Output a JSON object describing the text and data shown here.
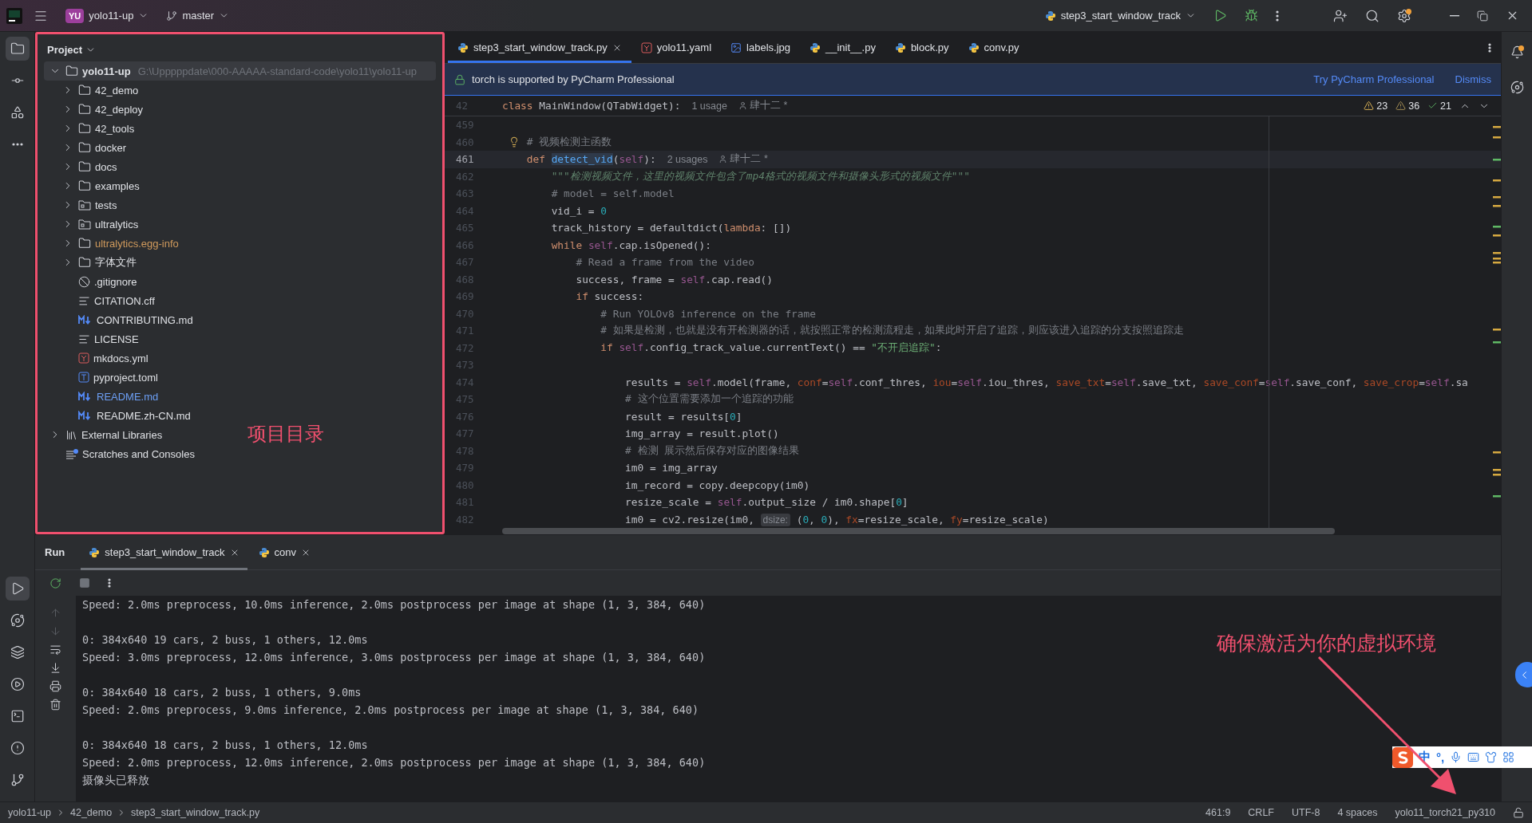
{
  "toolbar": {
    "project_badge": "YU",
    "project": "yolo11-up",
    "branch": "master",
    "run_config": "step3_start_window_track",
    "settings_update": true,
    "notifications_unread": true
  },
  "left_toolbar": {
    "top": [
      {
        "kind": "project",
        "selected": true
      },
      {
        "kind": "commit",
        "selected": false
      },
      {
        "kind": "structure",
        "selected": false
      },
      {
        "kind": "more",
        "selected": false
      }
    ],
    "bottom": [
      {
        "kind": "run",
        "selected": true
      },
      {
        "kind": "python-console",
        "selected": false
      },
      {
        "kind": "packages",
        "selected": false
      },
      {
        "kind": "services",
        "selected": false
      },
      {
        "kind": "terminal",
        "selected": false
      },
      {
        "kind": "problems",
        "selected": false
      },
      {
        "kind": "git",
        "selected": false
      }
    ]
  },
  "project": {
    "title": "Project",
    "root": {
      "name": "yolo11-up",
      "path": "G:\\Upppppdate\\000-AAAAA-standard-code\\yolo11\\yolo11-up",
      "expanded": true,
      "selected": true,
      "children": [
        {
          "name": "42_demo",
          "kind": "folder",
          "expanded": false
        },
        {
          "name": "42_deploy",
          "kind": "folder",
          "expanded": false
        },
        {
          "name": "42_tools",
          "kind": "folder",
          "expanded": false
        },
        {
          "name": "docker",
          "kind": "folder",
          "expanded": false
        },
        {
          "name": "docs",
          "kind": "folder",
          "expanded": false
        },
        {
          "name": "examples",
          "kind": "folder",
          "expanded": false
        },
        {
          "name": "tests",
          "kind": "source-folder",
          "expanded": false
        },
        {
          "name": "ultralytics",
          "kind": "source-folder",
          "expanded": false
        },
        {
          "name": "ultralytics.egg-info",
          "kind": "folder",
          "expanded": false,
          "color": "#d09a5c"
        },
        {
          "name": "字体文件",
          "kind": "folder",
          "expanded": false
        },
        {
          "name": ".gitignore",
          "kind": "ignore"
        },
        {
          "name": "CITATION.cff",
          "kind": "text"
        },
        {
          "name": "CONTRIBUTING.md",
          "kind": "markdown"
        },
        {
          "name": "LICENSE",
          "kind": "text"
        },
        {
          "name": "mkdocs.yml",
          "kind": "yaml"
        },
        {
          "name": "pyproject.toml",
          "kind": "toml"
        },
        {
          "name": "README.md",
          "kind": "markdown",
          "color": "#6c9ff5"
        },
        {
          "name": "README.zh-CN.md",
          "kind": "markdown"
        }
      ]
    },
    "extra": [
      {
        "name": "External Libraries",
        "kind": "libraries",
        "expanded": false
      },
      {
        "name": "Scratches and Consoles",
        "kind": "scratches"
      }
    ]
  },
  "editor_tabs": [
    {
      "label": "step3_start_window_track.py",
      "kind": "python",
      "selected": true
    },
    {
      "label": "yolo11.yaml",
      "kind": "yaml",
      "selected": false
    },
    {
      "label": "labels.jpg",
      "kind": "image",
      "selected": false
    },
    {
      "label": "__init__.py",
      "kind": "python",
      "selected": false
    },
    {
      "label": "block.py",
      "kind": "python",
      "selected": false
    },
    {
      "label": "conv.py",
      "kind": "python",
      "selected": false
    }
  ],
  "banner": {
    "text": "torch is supported by PyCharm Professional",
    "action": "Try PyCharm Professional",
    "dismiss": "Dismiss"
  },
  "inspections": {
    "warnings": "23",
    "weak_warnings": "36",
    "typos": "21"
  },
  "sticky_line": {
    "n": "42",
    "tokens": [
      {
        "kind": "kw",
        "t": "class"
      },
      {
        "kind": "plain",
        "t": " MainWindow(QTabWidget):"
      },
      {
        "kind": "hint",
        "t": "1 usage"
      },
      {
        "kind": "author",
        "t": "肆十二 *"
      }
    ]
  },
  "code_lines": [
    {
      "n": "459",
      "current": false,
      "bulb": false
    },
    {
      "n": "460",
      "current": false,
      "bulb": true,
      "tokens": [
        {
          "kind": "cmt",
          "t": "    # 视频检测主函数"
        }
      ]
    },
    {
      "n": "461",
      "current": true,
      "bulb": false,
      "tokens": [
        {
          "kind": "kw",
          "t": "    def "
        },
        {
          "kind": "fn",
          "t": "detect_vid"
        },
        {
          "kind": "plain",
          "t": "("
        },
        {
          "kind": "self",
          "t": "self"
        },
        {
          "kind": "plain",
          "t": "):"
        },
        {
          "kind": "hint",
          "t": "2 usages"
        },
        {
          "kind": "author",
          "t": "肆十二 *"
        }
      ]
    },
    {
      "n": "462",
      "current": false,
      "bulb": false,
      "tokens": [
        {
          "kind": "doc",
          "t": "        \"\"\"检测视频文件，这里的视频文件包含了mp4格式的视频文件和摄像头形式的视频文件\"\"\""
        }
      ]
    },
    {
      "n": "463",
      "current": false,
      "bulb": false,
      "tokens": [
        {
          "kind": "cmt",
          "t": "        # model = self.model"
        }
      ]
    },
    {
      "n": "464",
      "current": false,
      "bulb": false,
      "tokens": [
        {
          "kind": "plain",
          "t": "        vid_i = "
        },
        {
          "kind": "num",
          "t": "0"
        }
      ]
    },
    {
      "n": "465",
      "current": false,
      "bulb": false,
      "tokens": [
        {
          "kind": "plain",
          "t": "        track_history = defaultdict("
        },
        {
          "kind": "kw",
          "t": "lambda"
        },
        {
          "kind": "plain",
          "t": ": [])"
        }
      ]
    },
    {
      "n": "466",
      "current": false,
      "bulb": false,
      "tokens": [
        {
          "kind": "kw",
          "t": "        while "
        },
        {
          "kind": "self",
          "t": "self"
        },
        {
          "kind": "plain",
          "t": ".cap.isOpened():"
        }
      ]
    },
    {
      "n": "467",
      "current": false,
      "bulb": false,
      "tokens": [
        {
          "kind": "cmt",
          "t": "            # Read a frame from the video"
        }
      ]
    },
    {
      "n": "468",
      "current": false,
      "bulb": false,
      "tokens": [
        {
          "kind": "plain",
          "t": "            success, frame = "
        },
        {
          "kind": "self",
          "t": "self"
        },
        {
          "kind": "plain",
          "t": ".cap.read()"
        }
      ]
    },
    {
      "n": "469",
      "current": false,
      "bulb": false,
      "tokens": [
        {
          "kind": "kw",
          "t": "            if"
        },
        {
          "kind": "plain",
          "t": " success:"
        }
      ]
    },
    {
      "n": "470",
      "current": false,
      "bulb": false,
      "tokens": [
        {
          "kind": "cmt",
          "t": "                # Run YOLOv8 inference on the frame"
        }
      ]
    },
    {
      "n": "471",
      "current": false,
      "bulb": false,
      "tokens": [
        {
          "kind": "cmt",
          "t": "                # 如果是检测，也就是没有开检测器的话，就按照正常的检测流程走，如果此时开启了追踪，则应该进入追踪的分支按照追踪走"
        }
      ]
    },
    {
      "n": "472",
      "current": false,
      "bulb": false,
      "tokens": [
        {
          "kind": "kw",
          "t": "                if "
        },
        {
          "kind": "self",
          "t": "self"
        },
        {
          "kind": "plain",
          "t": ".config_track_value.currentText() == "
        },
        {
          "kind": "str",
          "t": "\"不开启追踪\""
        },
        {
          "kind": "plain",
          "t": ":"
        }
      ]
    },
    {
      "n": "473",
      "current": false,
      "bulb": false
    },
    {
      "n": "474",
      "current": false,
      "bulb": false,
      "tokens": [
        {
          "kind": "plain",
          "t": "                    results = "
        },
        {
          "kind": "self",
          "t": "self"
        },
        {
          "kind": "plain",
          "t": ".model(frame, "
        },
        {
          "kind": "param",
          "t": "conf"
        },
        {
          "kind": "plain",
          "t": "="
        },
        {
          "kind": "self",
          "t": "self"
        },
        {
          "kind": "plain",
          "t": ".conf_thres, "
        },
        {
          "kind": "param",
          "t": "iou"
        },
        {
          "kind": "plain",
          "t": "="
        },
        {
          "kind": "self",
          "t": "self"
        },
        {
          "kind": "plain",
          "t": ".iou_thres, "
        },
        {
          "kind": "param",
          "t": "save_txt"
        },
        {
          "kind": "plain",
          "t": "="
        },
        {
          "kind": "self",
          "t": "self"
        },
        {
          "kind": "plain",
          "t": ".save_txt, "
        },
        {
          "kind": "param",
          "t": "save_conf"
        },
        {
          "kind": "plain",
          "t": "="
        },
        {
          "kind": "self",
          "t": "self"
        },
        {
          "kind": "plain",
          "t": ".save_conf, "
        },
        {
          "kind": "param",
          "t": "save_crop"
        },
        {
          "kind": "plain",
          "t": "="
        },
        {
          "kind": "self",
          "t": "self"
        },
        {
          "kind": "plain",
          "t": ".sa"
        }
      ]
    },
    {
      "n": "475",
      "current": false,
      "bulb": false,
      "tokens": [
        {
          "kind": "cmt",
          "t": "                    # 这个位置需要添加一个追踪的功能"
        }
      ]
    },
    {
      "n": "476",
      "current": false,
      "bulb": false,
      "tokens": [
        {
          "kind": "plain",
          "t": "                    result = results["
        },
        {
          "kind": "num",
          "t": "0"
        },
        {
          "kind": "plain",
          "t": "]"
        }
      ]
    },
    {
      "n": "477",
      "current": false,
      "bulb": false,
      "tokens": [
        {
          "kind": "plain",
          "t": "                    img_array = result.plot()"
        }
      ]
    },
    {
      "n": "478",
      "current": false,
      "bulb": false,
      "tokens": [
        {
          "kind": "cmt",
          "t": "                    # 检测 展示然后保存对应的图像结果"
        }
      ]
    },
    {
      "n": "479",
      "current": false,
      "bulb": false,
      "tokens": [
        {
          "kind": "plain",
          "t": "                    im0 = img_array"
        }
      ]
    },
    {
      "n": "480",
      "current": false,
      "bulb": false,
      "tokens": [
        {
          "kind": "plain",
          "t": "                    im_record = copy.deepcopy(im0)"
        }
      ]
    },
    {
      "n": "481",
      "current": false,
      "bulb": false,
      "tokens": [
        {
          "kind": "plain",
          "t": "                    resize_scale = "
        },
        {
          "kind": "self",
          "t": "self"
        },
        {
          "kind": "plain",
          "t": ".output_size / im0.shape["
        },
        {
          "kind": "num",
          "t": "0"
        },
        {
          "kind": "plain",
          "t": "]"
        }
      ]
    },
    {
      "n": "482",
      "current": false,
      "bulb": false,
      "tokens": [
        {
          "kind": "plain",
          "t": "                    im0 = cv2.resize(im0, "
        },
        {
          "kind": "inlay",
          "t": "dsize:"
        },
        {
          "kind": "plain",
          "t": " ("
        },
        {
          "kind": "num",
          "t": "0"
        },
        {
          "kind": "plain",
          "t": ", "
        },
        {
          "kind": "num",
          "t": "0"
        },
        {
          "kind": "plain",
          "t": "), "
        },
        {
          "kind": "param",
          "t": "fx"
        },
        {
          "kind": "plain",
          "t": "=resize_scale, "
        },
        {
          "kind": "param",
          "t": "fy"
        },
        {
          "kind": "plain",
          "t": "=resize_scale)"
        }
      ]
    }
  ],
  "run": {
    "title": "Run",
    "tabs": [
      {
        "label": "step3_start_window_track",
        "selected": true
      },
      {
        "label": "conv",
        "selected": false
      }
    ],
    "output_groups": [
      [
        "Speed: 2.0ms preprocess, 10.0ms inference, 2.0ms postprocess per image at shape (1, 3, 384, 640)"
      ],
      [
        "0: 384x640 19 cars, 2 buss, 1 others, 12.0ms",
        "Speed: 3.0ms preprocess, 12.0ms inference, 3.0ms postprocess per image at shape (1, 3, 384, 640)"
      ],
      [
        "0: 384x640 18 cars, 2 buss, 1 others, 9.0ms",
        "Speed: 2.0ms preprocess, 9.0ms inference, 2.0ms postprocess per image at shape (1, 3, 384, 640)"
      ],
      [
        "0: 384x640 18 cars, 2 buss, 1 others, 12.0ms",
        "Speed: 2.0ms preprocess, 12.0ms inference, 2.0ms postprocess per image at shape (1, 3, 384, 640)",
        "摄像头已释放"
      ]
    ]
  },
  "status_bar": {
    "breadcrumb": [
      "yolo11-up",
      "42_demo",
      "step3_start_window_track.py"
    ],
    "items": [
      "461:9",
      "CRLF",
      "UTF-8",
      "4 spaces",
      "yolo11_torch21_py310"
    ]
  },
  "ime_toolbar": {
    "mode": "中",
    "punctuation": "°,"
  },
  "annotations": [
    {
      "kind": "frame-label",
      "text": "项目目录"
    },
    {
      "kind": "arrow-label",
      "text": "确保激活为你的虚拟环境"
    }
  ]
}
